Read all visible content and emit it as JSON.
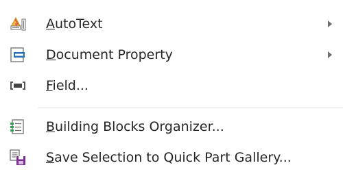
{
  "menu": {
    "items": [
      {
        "mnemonic": "A",
        "rest": "utoText",
        "has_submenu": true,
        "icon": "autotext-icon"
      },
      {
        "mnemonic": "D",
        "rest": "ocument Property",
        "has_submenu": true,
        "icon": "document-property-icon"
      },
      {
        "mnemonic": "F",
        "rest": "ield...",
        "has_submenu": false,
        "icon": "field-icon"
      },
      {
        "mnemonic": "B",
        "rest": "uilding Blocks Organizer...",
        "has_submenu": false,
        "icon": "building-blocks-icon"
      },
      {
        "mnemonic": "S",
        "rest": "ave Selection to Quick Part Gallery...",
        "has_submenu": false,
        "icon": "save-selection-icon"
      }
    ]
  },
  "colors": {
    "text": "#262626",
    "accent_blue": "#2b6fb6",
    "accent_purple": "#7a2f8f",
    "submenu_arrow": "#6e6e6e",
    "separator": "#e1e1e1"
  }
}
